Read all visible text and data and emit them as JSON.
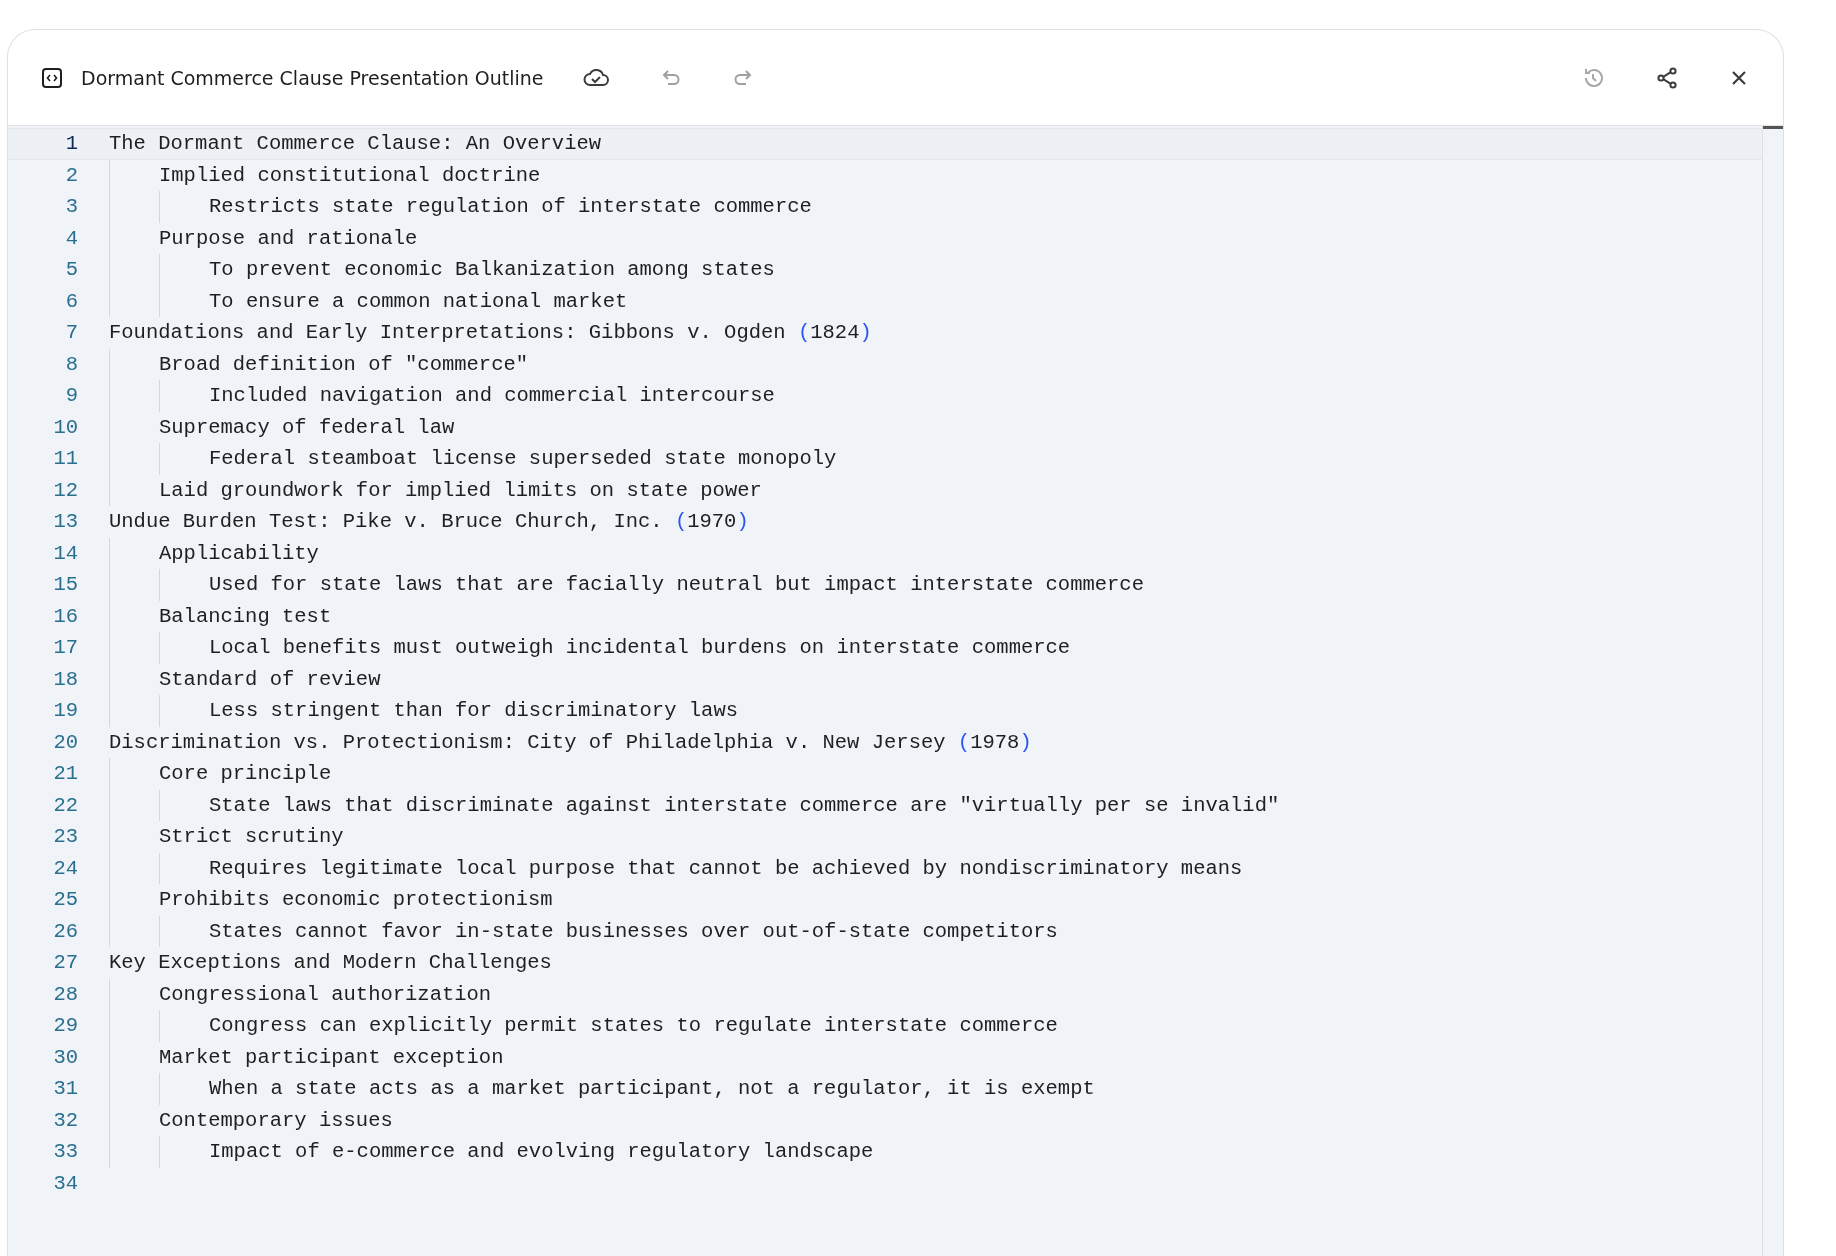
{
  "header": {
    "title": "Dormant Commerce Clause Presentation Outline",
    "history_disabled": true
  },
  "lines": [
    {
      "number": "1",
      "current": true,
      "text": "The Dormant Commerce Clause: An Overview",
      "children": [
        {
          "number": "2",
          "current": false,
          "text": "Implied constitutional doctrine",
          "children": [
            {
              "number": "3",
              "current": false,
              "text": "Restricts state regulation of interstate commerce"
            }
          ]
        },
        {
          "number": "4",
          "current": false,
          "text": "Purpose and rationale",
          "children": [
            {
              "number": "5",
              "current": false,
              "text": "To prevent economic Balkanization among states"
            },
            {
              "number": "6",
              "current": false,
              "text": "To ensure a common national market"
            }
          ]
        }
      ]
    },
    {
      "number": "7",
      "current": false,
      "text": "Foundations and Early Interpretations: Gibbons v. Ogden ",
      "paren": {
        "open": "(",
        "inner": "1824",
        "close": ")"
      },
      "children": [
        {
          "number": "8",
          "current": false,
          "text": "Broad definition of \"commerce\"",
          "children": [
            {
              "number": "9",
              "current": false,
              "text": "Included navigation and commercial intercourse"
            }
          ]
        },
        {
          "number": "10",
          "current": false,
          "text": "Supremacy of federal law",
          "children": [
            {
              "number": "11",
              "current": false,
              "text": "Federal steamboat license superseded state monopoly"
            }
          ]
        },
        {
          "number": "12",
          "current": false,
          "text": "Laid groundwork for implied limits on state power"
        }
      ]
    },
    {
      "number": "13",
      "current": false,
      "text": "Undue Burden Test: Pike v. Bruce Church, Inc. ",
      "paren": {
        "open": "(",
        "inner": "1970",
        "close": ")"
      },
      "children": [
        {
          "number": "14",
          "current": false,
          "text": "Applicability",
          "children": [
            {
              "number": "15",
              "current": false,
              "text": "Used for state laws that are facially neutral but impact interstate commerce"
            }
          ]
        },
        {
          "number": "16",
          "current": false,
          "text": "Balancing test",
          "children": [
            {
              "number": "17",
              "current": false,
              "text": "Local benefits must outweigh incidental burdens on interstate commerce"
            }
          ]
        },
        {
          "number": "18",
          "current": false,
          "text": "Standard of review",
          "children": [
            {
              "number": "19",
              "current": false,
              "text": "Less stringent than for discriminatory laws"
            }
          ]
        }
      ]
    },
    {
      "number": "20",
      "current": false,
      "text": "Discrimination vs. Protectionism: City of Philadelphia v. New Jersey ",
      "paren": {
        "open": "(",
        "inner": "1978",
        "close": ")"
      },
      "children": [
        {
          "number": "21",
          "current": false,
          "text": "Core principle",
          "children": [
            {
              "number": "22",
              "current": false,
              "text": "State laws that discriminate against interstate commerce are \"virtually per se invalid\""
            }
          ]
        },
        {
          "number": "23",
          "current": false,
          "text": "Strict scrutiny",
          "children": [
            {
              "number": "24",
              "current": false,
              "text": "Requires legitimate local purpose that cannot be achieved by nondiscriminatory means"
            }
          ]
        },
        {
          "number": "25",
          "current": false,
          "text": "Prohibits economic protectionism",
          "children": [
            {
              "number": "26",
              "current": false,
              "text": "States cannot favor in-state businesses over out-of-state competitors"
            }
          ]
        }
      ]
    },
    {
      "number": "27",
      "current": false,
      "text": "Key Exceptions and Modern Challenges",
      "children": [
        {
          "number": "28",
          "current": false,
          "text": "Congressional authorization",
          "children": [
            {
              "number": "29",
              "current": false,
              "text": "Congress can explicitly permit states to regulate interstate commerce"
            }
          ]
        },
        {
          "number": "30",
          "current": false,
          "text": "Market participant exception",
          "children": [
            {
              "number": "31",
              "current": false,
              "text": "When a state acts as a market participant, not a regulator, it is exempt"
            }
          ]
        },
        {
          "number": "32",
          "current": false,
          "text": "Contemporary issues",
          "children": [
            {
              "number": "33",
              "current": false,
              "text": "Impact of e-commerce and evolving regulatory landscape"
            }
          ]
        }
      ]
    },
    {
      "number": "34",
      "current": false
    }
  ]
}
